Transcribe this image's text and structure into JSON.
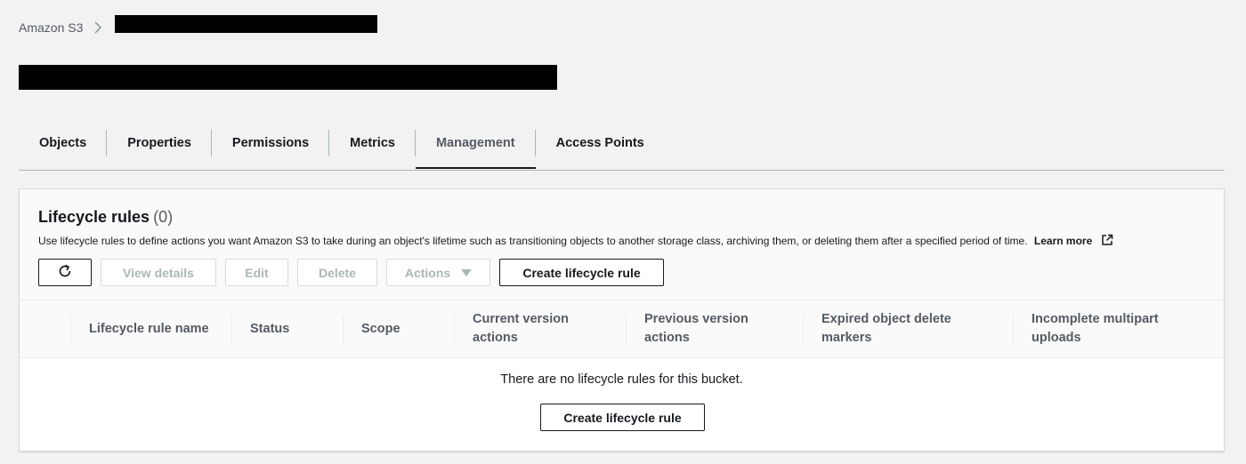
{
  "breadcrumb": {
    "root": "Amazon S3"
  },
  "tabs": [
    {
      "label": "Objects"
    },
    {
      "label": "Properties"
    },
    {
      "label": "Permissions"
    },
    {
      "label": "Metrics"
    },
    {
      "label": "Management"
    },
    {
      "label": "Access Points"
    }
  ],
  "active_tab": "Management",
  "lifecycle": {
    "title": "Lifecycle rules",
    "count": "(0)",
    "description": "Use lifecycle rules to define actions you want Amazon S3 to take during an object's lifetime such as transitioning objects to another storage class, archiving them, or deleting them after a specified period of time.",
    "learn_more": "Learn more",
    "toolbar": {
      "view_details": "View details",
      "edit": "Edit",
      "delete": "Delete",
      "actions": "Actions",
      "create": "Create lifecycle rule"
    },
    "columns": [
      {
        "line1": "Lifecycle rule name",
        "line2": ""
      },
      {
        "line1": "Status",
        "line2": ""
      },
      {
        "line1": "Scope",
        "line2": ""
      },
      {
        "line1": "Current version",
        "line2": "actions"
      },
      {
        "line1": "Previous version",
        "line2": "actions"
      },
      {
        "line1": "Expired object delete",
        "line2": "markers"
      },
      {
        "line1": "Incomplete multipart",
        "line2": "uploads"
      }
    ],
    "empty_message": "There are no lifecycle rules for this bucket.",
    "empty_button": "Create lifecycle rule"
  },
  "icons": {
    "refresh": "refresh-icon",
    "external": "external-link-icon",
    "caret": "caret-down-icon",
    "chevron": "chevron-right-icon"
  },
  "colors": {
    "background": "#f2f2f2",
    "text": "#16191f",
    "muted": "#545b64",
    "disabled": "#aab7b8",
    "border": "#d5dbdb"
  }
}
